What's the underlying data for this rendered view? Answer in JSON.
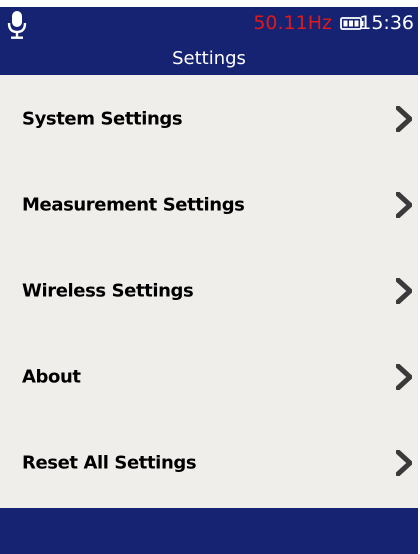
{
  "status_bar": {
    "frequency": "50.11Hz",
    "time": "15:36",
    "mic_icon": "microphone-icon",
    "battery_icon": "battery-icon"
  },
  "header": {
    "title": "Settings"
  },
  "menu": {
    "items": [
      {
        "label": "System Settings",
        "icon": "chevron-right-icon"
      },
      {
        "label": "Measurement Settings",
        "icon": "chevron-right-icon"
      },
      {
        "label": "Wireless Settings",
        "icon": "chevron-right-icon"
      },
      {
        "label": "About",
        "icon": "chevron-right-icon"
      },
      {
        "label": "Reset All Settings",
        "icon": "chevron-right-icon"
      }
    ]
  },
  "colors": {
    "header_bg": "#152372",
    "frequency_text": "#e01a1a",
    "menu_bg": "#f0eeea",
    "chevron": "#3a3a3a"
  }
}
